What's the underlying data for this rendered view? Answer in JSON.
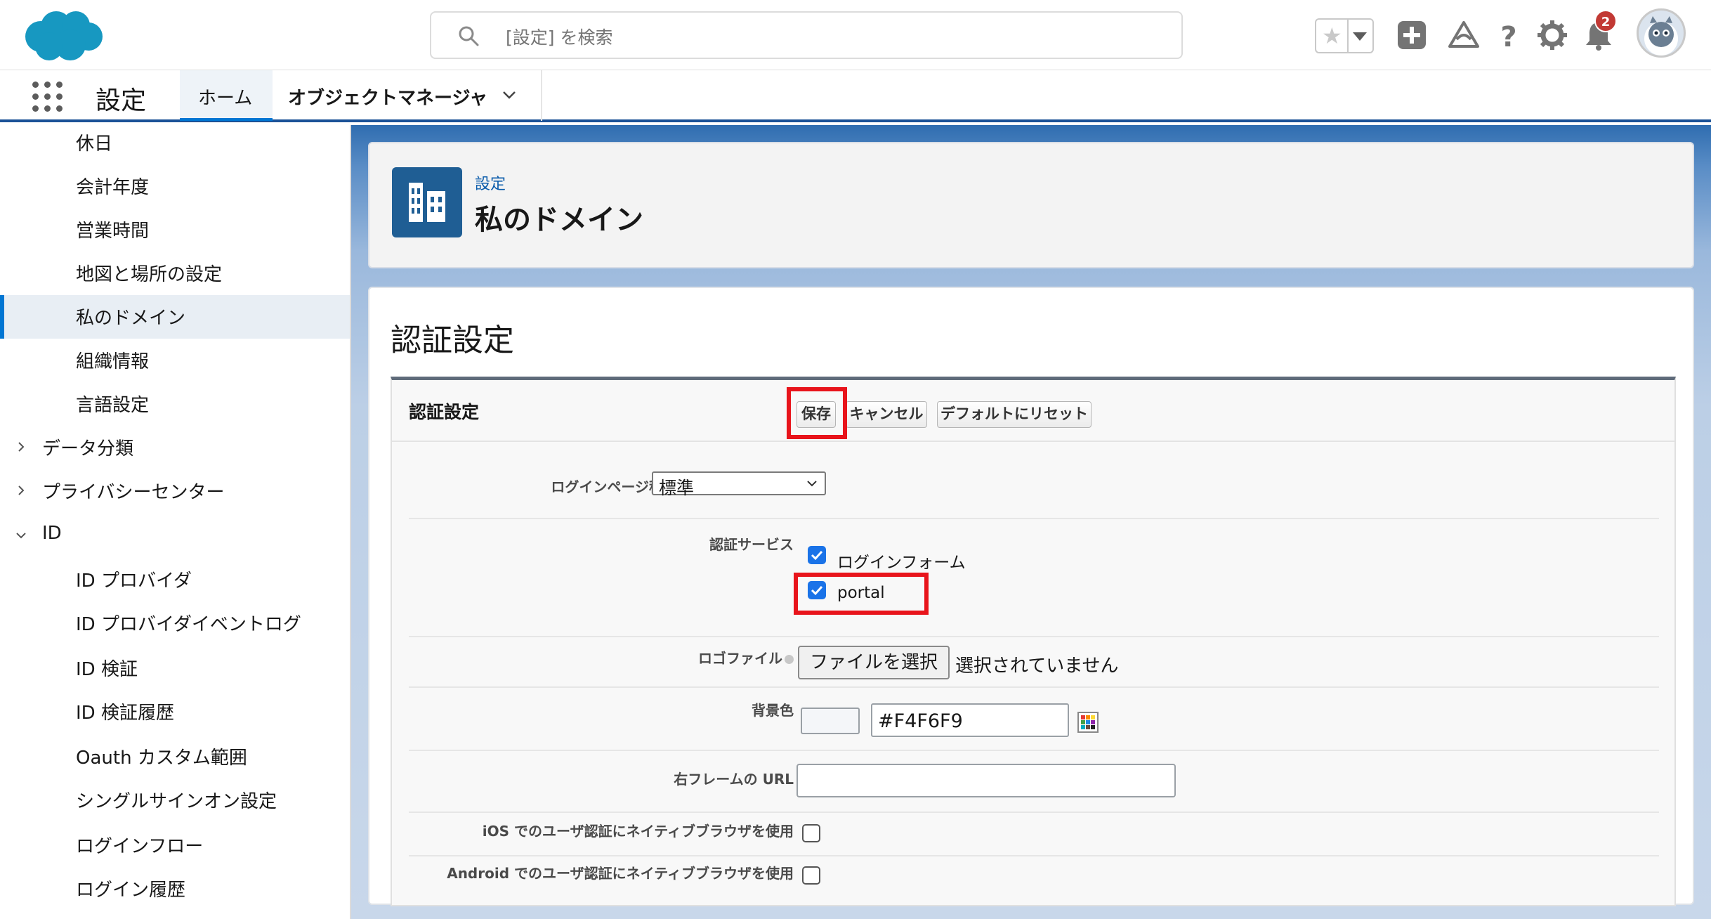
{
  "header": {
    "search_placeholder": "[設定] を検索",
    "notification_count": "2",
    "brand_color": "#1798c1"
  },
  "nav": {
    "app_name": "設定",
    "tabs": [
      {
        "label": "ホーム"
      },
      {
        "label": "オブジェクトマネージャ"
      }
    ]
  },
  "sidebar": {
    "items": [
      {
        "label": "休日"
      },
      {
        "label": "会計年度"
      },
      {
        "label": "営業時間"
      },
      {
        "label": "地図と場所の設定"
      },
      {
        "label": "私のドメイン",
        "active": true
      },
      {
        "label": "組織情報"
      },
      {
        "label": "言語設定"
      },
      {
        "label": "データ分類"
      },
      {
        "label": "プライバシーセンター"
      },
      {
        "label": "ID"
      },
      {
        "label": "ID プロバイダ"
      },
      {
        "label": "ID プロバイダイベントログ"
      },
      {
        "label": "ID 検証"
      },
      {
        "label": "ID 検証履歴"
      },
      {
        "label": "Oauth カスタム範囲"
      },
      {
        "label": "シングルサインオン設定"
      },
      {
        "label": "ログインフロー"
      },
      {
        "label": "ログイン履歴"
      }
    ]
  },
  "page_header": {
    "breadcrumb": "設定",
    "title": "私のドメイン"
  },
  "content": {
    "title": "認証設定",
    "section": {
      "title": "認証設定",
      "buttons": {
        "save": "保存",
        "cancel": "キャンセル",
        "reset": "デフォルトにリセット"
      },
      "login_page_type": {
        "label": "ログインページ種別",
        "value": "標準"
      },
      "auth_service": {
        "label": "認証サービス",
        "options": [
          {
            "label": "ログインフォーム",
            "checked": true
          },
          {
            "label": "portal",
            "checked": true
          }
        ]
      },
      "logo_file": {
        "label": "ロゴファイル",
        "button": "ファイルを選択",
        "status": "選択されていません"
      },
      "background_color": {
        "label": "背景色",
        "value": "#F4F6F9"
      },
      "right_frame_url": {
        "label": "右フレームの URL",
        "value": ""
      },
      "ios_native_browser": {
        "label": "iOS でのユーザ認証にネイティブブラウザを使用",
        "checked": false
      },
      "android_native_browser": {
        "label": "Android でのユーザ認証にネイティブブラウザを使用",
        "checked": false
      }
    }
  },
  "colors": {
    "accent": "#0176d3",
    "highlight": "#e8141b",
    "header_band": "#1b5297"
  }
}
